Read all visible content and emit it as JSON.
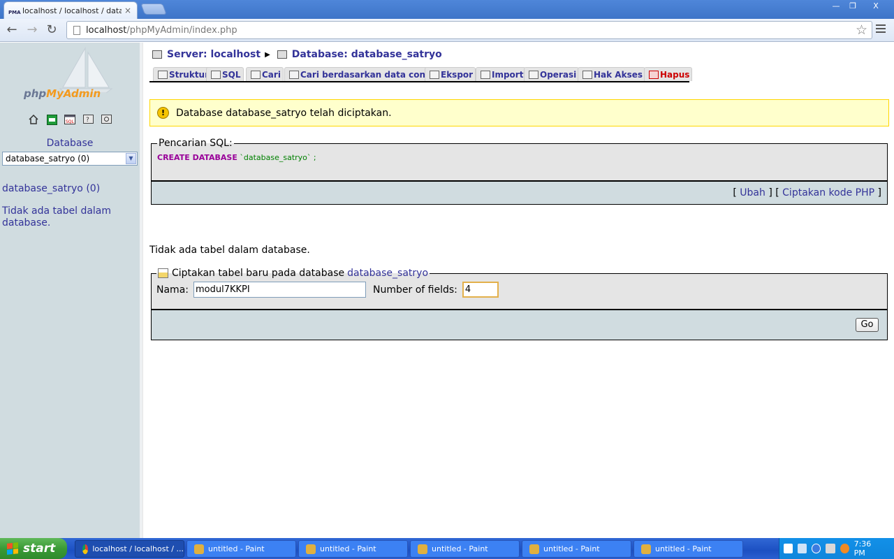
{
  "browser": {
    "tab_title": "localhost / localhost / databas",
    "tab_close": "×",
    "favicon_label": "PMA",
    "window_controls": {
      "minimize": "—",
      "maximize": "❐",
      "close": "X"
    },
    "url_host": "localhost",
    "url_path": "/phpMyAdmin/index.php"
  },
  "sidebar": {
    "logo_prefix": "php",
    "logo_accent": "MyAdmin",
    "quick_icons": [
      "home-icon",
      "exit-icon",
      "sql-icon",
      "query-window-icon",
      "reload-icon"
    ],
    "database_label": "Database",
    "selected_database": "database_satryo (0)",
    "database_link": "database_satryo (0)",
    "no_tables_text": "Tidak ada tabel dalam database."
  },
  "breadcrumb": {
    "server": "Server: localhost",
    "database": "Database: database_satryo"
  },
  "tabs": [
    {
      "label": "Struktur",
      "icon": "structure-icon"
    },
    {
      "label": "SQL",
      "icon": "sql-icon"
    },
    {
      "label": "Cari",
      "icon": "search-icon"
    },
    {
      "label": "Cari berdasarkan data contoh",
      "icon": "query-icon"
    },
    {
      "label": "Ekspor",
      "icon": "export-icon"
    },
    {
      "label": "Import",
      "icon": "import-icon"
    },
    {
      "label": "Operasi",
      "icon": "operations-icon"
    },
    {
      "label": "Hak Akses",
      "icon": "privileges-icon"
    },
    {
      "label": "Hapus",
      "icon": "drop-icon"
    }
  ],
  "notice": {
    "icon": "info-icon",
    "message": "Database database_satryo telah diciptakan."
  },
  "sql_query": {
    "legend": "Pencarian SQL:",
    "keyword": "CREATE DATABASE",
    "argument": "`database_satryo`",
    "terminator": " ;",
    "link_open": "[ ",
    "edit_link": "Ubah",
    "link_mid": " ] [ ",
    "php_link": "Ciptakan kode PHP",
    "link_close": " ]"
  },
  "main": {
    "no_tables_text": "Tidak ada tabel dalam database."
  },
  "create_table": {
    "legend": "Ciptakan tabel baru pada database",
    "database_name": "database_satryo",
    "name_label": "Nama:",
    "name_value": "modul7KKPI",
    "fields_label": "Number of fields:",
    "fields_value": "4",
    "go_label": "Go"
  },
  "taskbar": {
    "start_label": "start",
    "tasks": [
      {
        "label": "localhost / localhost / ...",
        "icon": "chrome-icon",
        "active": true
      },
      {
        "label": "untitled - Paint",
        "icon": "paint-icon"
      },
      {
        "label": "untitled - Paint",
        "icon": "paint-icon"
      },
      {
        "label": "untitled - Paint",
        "icon": "paint-icon"
      },
      {
        "label": "untitled - Paint",
        "icon": "paint-icon"
      },
      {
        "label": "untitled - Paint",
        "icon": "paint-icon"
      }
    ],
    "clock": "7:36 PM"
  },
  "colors": {
    "link": "#333399",
    "sidebar_bg": "#d0dce0",
    "notice_bg": "#ffffcc",
    "drop_tab": "#cc0000",
    "sql_keyword": "#990099",
    "sql_string": "#008000"
  }
}
